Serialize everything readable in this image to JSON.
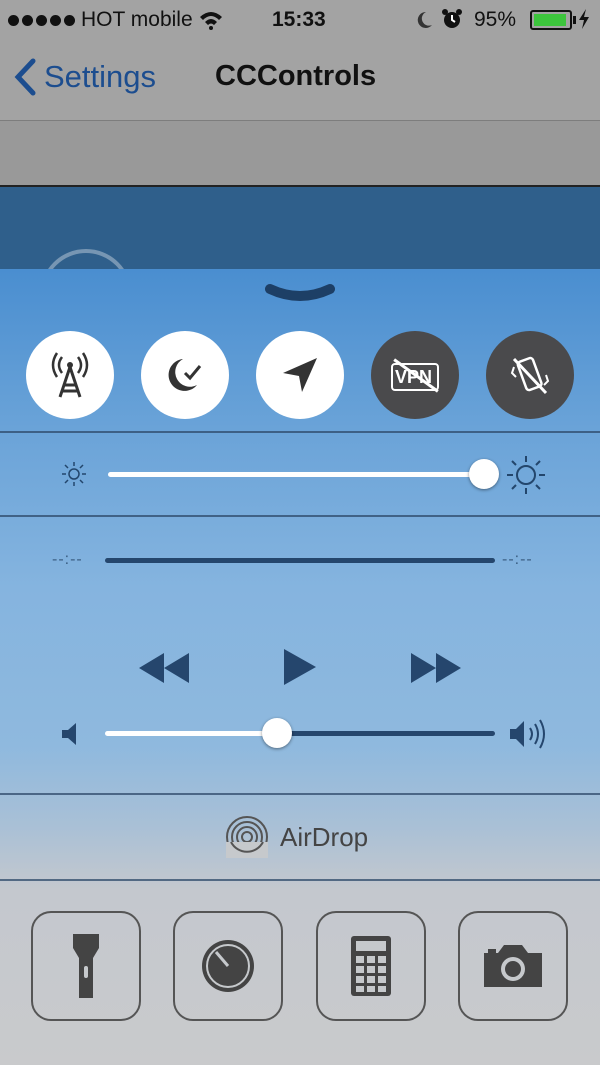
{
  "status_bar": {
    "carrier": "HOT mobile",
    "time": "15:33",
    "battery_percent": "95%"
  },
  "nav": {
    "back_label": "Settings",
    "title": "CCControls"
  },
  "control_center": {
    "toggles": [
      {
        "icon": "cellular-tower-icon",
        "state": "on"
      },
      {
        "icon": "do-not-disturb-moon-icon",
        "state": "on"
      },
      {
        "icon": "location-arrow-icon",
        "state": "on"
      },
      {
        "icon": "vpn-icon",
        "state": "off",
        "text": "VPN"
      },
      {
        "icon": "vibrate-off-icon",
        "state": "off"
      }
    ],
    "brightness": {
      "level": 0.98
    },
    "music": {
      "elapsed": "--:--",
      "remaining": "--:--",
      "progress": 0
    },
    "volume": {
      "level": 0.44
    },
    "airdrop_label": "AirDrop",
    "shortcuts": [
      "flashlight-icon",
      "timer-icon",
      "calculator-icon",
      "camera-icon"
    ]
  },
  "colors": {
    "accent": "#1c4d8f",
    "toggle_off": "#4a4a4c",
    "media": "#25466d",
    "battery_green": "#3cc43c"
  }
}
